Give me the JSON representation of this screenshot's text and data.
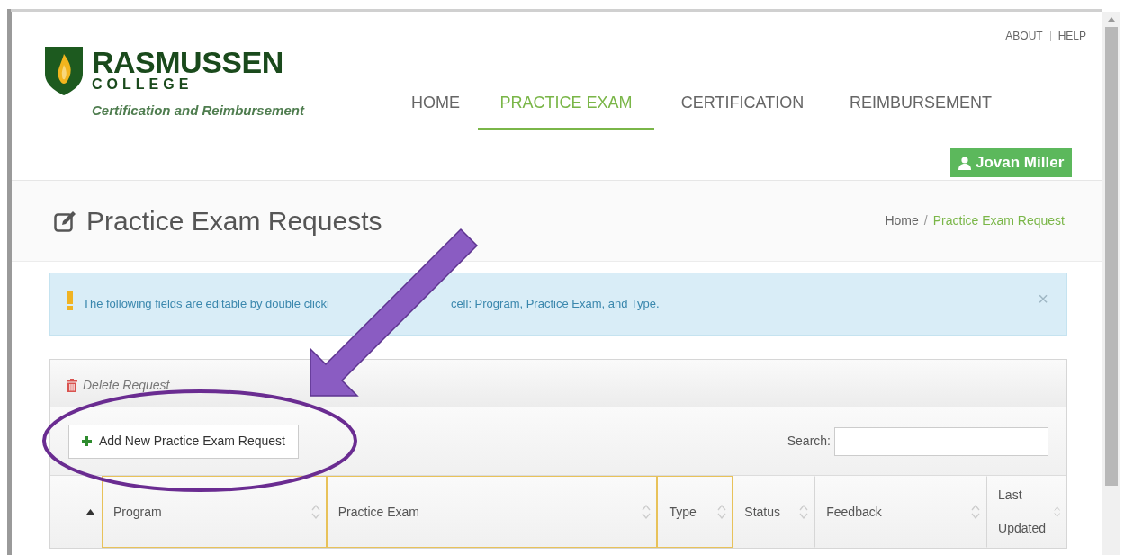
{
  "header": {
    "logo_name": "RASMUSSEN",
    "logo_sub": "COLLEGE",
    "tagline": "Certification and Reimbursement",
    "top_links": [
      "ABOUT",
      "HELP"
    ],
    "user": "Jovan Miller"
  },
  "nav": [
    {
      "label": "HOME",
      "selected": false
    },
    {
      "label": "PRACTICE EXAM",
      "selected": true
    },
    {
      "label": "CERTIFICATION",
      "selected": false
    },
    {
      "label": "REIMBURSEMENT",
      "selected": false
    }
  ],
  "page": {
    "title": "Practice Exam Requests",
    "breadcrumb_separator": "/",
    "breadcrumb": [
      {
        "label": "Home",
        "selected": false
      },
      {
        "label": "Practice Exam Request",
        "selected": true
      }
    ]
  },
  "alert": {
    "text_before": "The following fields are editable by double clicki",
    "text_after": "cell: Program, Practice Exam, and Type.",
    "close": "×"
  },
  "toolbar": {
    "delete": "Delete Request",
    "add": "Add New Practice Exam Request",
    "search_label": "Search:"
  },
  "table": {
    "columns": [
      {
        "label": "Program",
        "highlighted": true
      },
      {
        "label": "Practice Exam",
        "highlighted": true
      },
      {
        "label": "Type",
        "highlighted": true
      },
      {
        "label": "Status",
        "highlighted": false
      },
      {
        "label": "Feedback",
        "highlighted": false
      },
      {
        "label": "Last Updated",
        "highlighted": false
      }
    ]
  }
}
